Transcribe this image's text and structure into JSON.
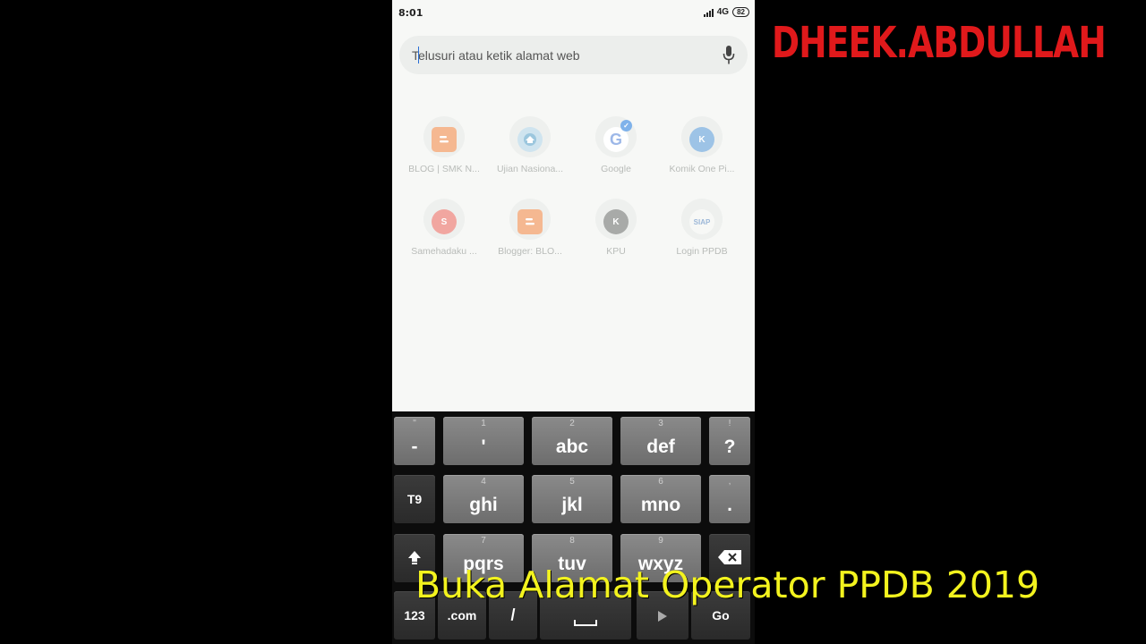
{
  "status_bar": {
    "time": "8:01",
    "network": "4G",
    "battery": "82"
  },
  "search": {
    "placeholder": "Telusuri atau ketik alamat web"
  },
  "icons": {
    "mic": "mic-icon",
    "backspace": "backspace-icon",
    "shift": "shift-arrow-icon",
    "next": "next-arrow-icon",
    "space": "space-bar-icon"
  },
  "shortcuts": [
    {
      "label": "BLOG | SMK N...",
      "letter": "",
      "icon": "blogger-icon",
      "color": "#f5b891"
    },
    {
      "label": "Ujian Nasiona...",
      "letter": "",
      "icon": "kemdikbud-logo-icon",
      "color": "#a9cfe6"
    },
    {
      "label": "Google",
      "letter": "G",
      "icon": "google-icon",
      "color": "#ffffff",
      "badge": "✓"
    },
    {
      "label": "Komik One Pi...",
      "letter": "K",
      "icon": "letter-k-icon",
      "color": "#9dc3e6"
    },
    {
      "label": "Samehadaku ...",
      "letter": "S",
      "icon": "letter-s-icon",
      "color": "#f1a6a0"
    },
    {
      "label": "Blogger: BLO...",
      "letter": "",
      "icon": "blogger-icon",
      "color": "#f5b891"
    },
    {
      "label": "KPU",
      "letter": "K",
      "icon": "letter-k-icon",
      "color": "#a8aaa8"
    },
    {
      "label": "Login PPDB",
      "letter": "SIAP",
      "icon": "siap-logo-icon",
      "color": "#f7f8f6"
    }
  ],
  "keyboard": {
    "row1": [
      {
        "sub": "\"",
        "main": "-"
      },
      {
        "sub": "1",
        "main": "'"
      },
      {
        "sub": "2",
        "main": "abc"
      },
      {
        "sub": "3",
        "main": "def"
      },
      {
        "sub": "!",
        "main": "?"
      }
    ],
    "row2": [
      {
        "sub": "",
        "main": "T9"
      },
      {
        "sub": "4",
        "main": "ghi"
      },
      {
        "sub": "5",
        "main": "jkl"
      },
      {
        "sub": "6",
        "main": "mno"
      },
      {
        "sub": ",",
        "main": "."
      }
    ],
    "row3": [
      {
        "sub": "7",
        "main": "pqrs"
      },
      {
        "sub": "8",
        "main": "tuv"
      },
      {
        "sub": "9",
        "main": "wxyz"
      }
    ],
    "row4": [
      {
        "main": "123"
      },
      {
        "main": ".com"
      },
      {
        "main": "/"
      },
      {
        "main": "Go"
      }
    ]
  },
  "overlay": {
    "channel": "DHEEK.ABDULLAH",
    "caption": "Buka Alamat Operator PPDB 2019"
  }
}
